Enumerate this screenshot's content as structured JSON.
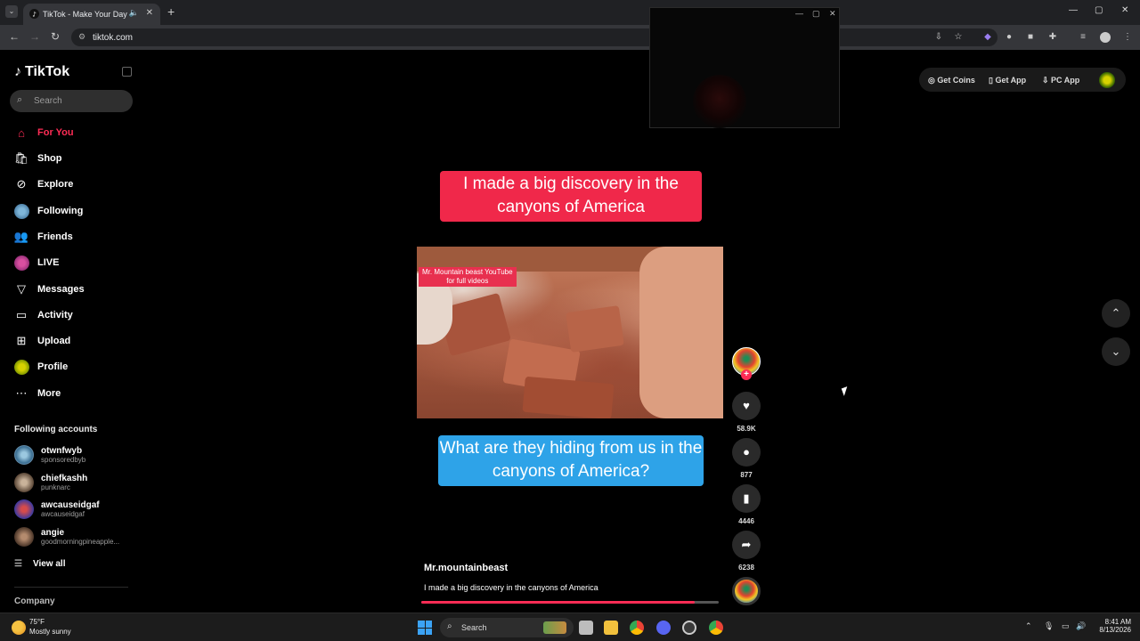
{
  "browser": {
    "tab_title": "TikTok - Make Your Day",
    "url": "tiktok.com"
  },
  "sidebar": {
    "logo_text": "TikTok",
    "search_placeholder": "Search",
    "nav": [
      {
        "label": "For You",
        "icon": "home-icon",
        "active": true
      },
      {
        "label": "Shop",
        "icon": "shopping-bag-icon"
      },
      {
        "label": "Explore",
        "icon": "compass-icon"
      },
      {
        "label": "Following",
        "icon": "avatar-icon"
      },
      {
        "label": "Friends",
        "icon": "friends-icon"
      },
      {
        "label": "LIVE",
        "icon": "avatar-icon"
      },
      {
        "label": "Messages",
        "icon": "messages-icon"
      },
      {
        "label": "Activity",
        "icon": "activity-icon"
      },
      {
        "label": "Upload",
        "icon": "plus-square-icon"
      },
      {
        "label": "Profile",
        "icon": "avatar-icon"
      },
      {
        "label": "More",
        "icon": "more-icon"
      }
    ],
    "following_accounts_heading": "Following accounts",
    "following_accounts": [
      {
        "name": "otwnfwyb",
        "sub": "sponsoredbyb"
      },
      {
        "name": "chiefkashh",
        "sub": "punknarc"
      },
      {
        "name": "awcauseidgaf",
        "sub": "awcauseidgaf"
      },
      {
        "name": "angie",
        "sub": "goodmorningpineapple..."
      }
    ],
    "view_all": "View all",
    "company": "Company"
  },
  "header_actions": {
    "get_coins": "Get Coins",
    "get_app": "Get App",
    "pc_app": "PC App"
  },
  "video": {
    "top_caption": "I made a big discovery in the canyons of America",
    "overlay_tag_line1": "Mr. Mountain beast YouTube",
    "overlay_tag_line2": "for full videos",
    "bottom_caption": "What are they hiding from us in the canyons of America?",
    "author": "Mr.mountainbeast",
    "description": "I made a big discovery in the canyons of America",
    "progress": 0.92
  },
  "actions": {
    "likes": "58.9K",
    "comments": "877",
    "saves": "4446",
    "shares": "6238"
  },
  "taskbar": {
    "temperature": "75°F",
    "weather": "Mostly sunny",
    "search_label": "Search",
    "time": "8:41 AM",
    "date": "8/13/2026"
  },
  "colors": {
    "brand_red": "#fe2c55",
    "caption_red": "#f0284a",
    "caption_blue": "#2ea3e8"
  }
}
